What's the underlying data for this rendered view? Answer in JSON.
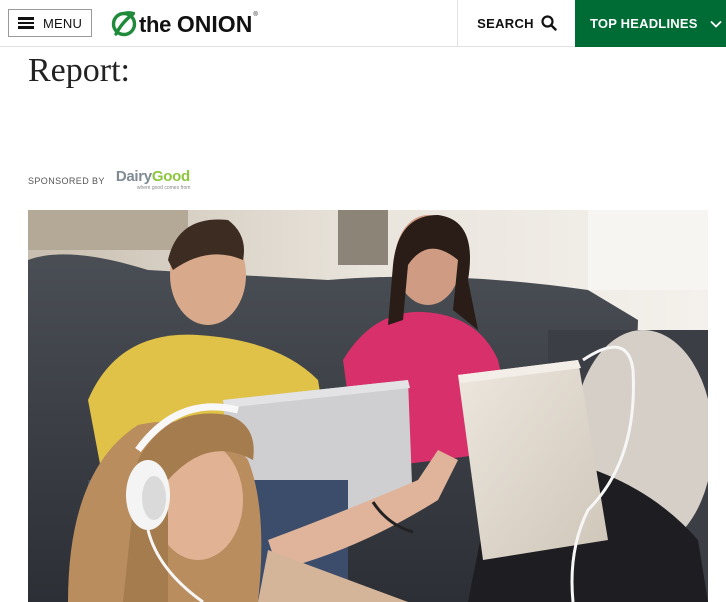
{
  "header": {
    "menu_label": "MENU",
    "logo_text_the": "the",
    "logo_text_onion": "ONION",
    "logo_reg": "®",
    "search_label": "SEARCH",
    "headlines_label": "TOP HEADLINES"
  },
  "article": {
    "title_fragment": "Report:",
    "sponsored_by": "SPONSORED BY",
    "sponsor_name_a": "Dairy",
    "sponsor_name_b": "Good",
    "sponsor_tagline": "where good comes from"
  },
  "colors": {
    "brand_green": "#006c35",
    "logo_green": "#1f8a3a",
    "sponsor_green": "#8dc640",
    "sponsor_gray": "#7f8a93"
  },
  "icons": [
    "hamburger-icon",
    "onion-leaf-icon",
    "search-icon",
    "chevron-down-icon"
  ],
  "hero_image": "family on couch with laptop and tablet, girl wearing headphones"
}
